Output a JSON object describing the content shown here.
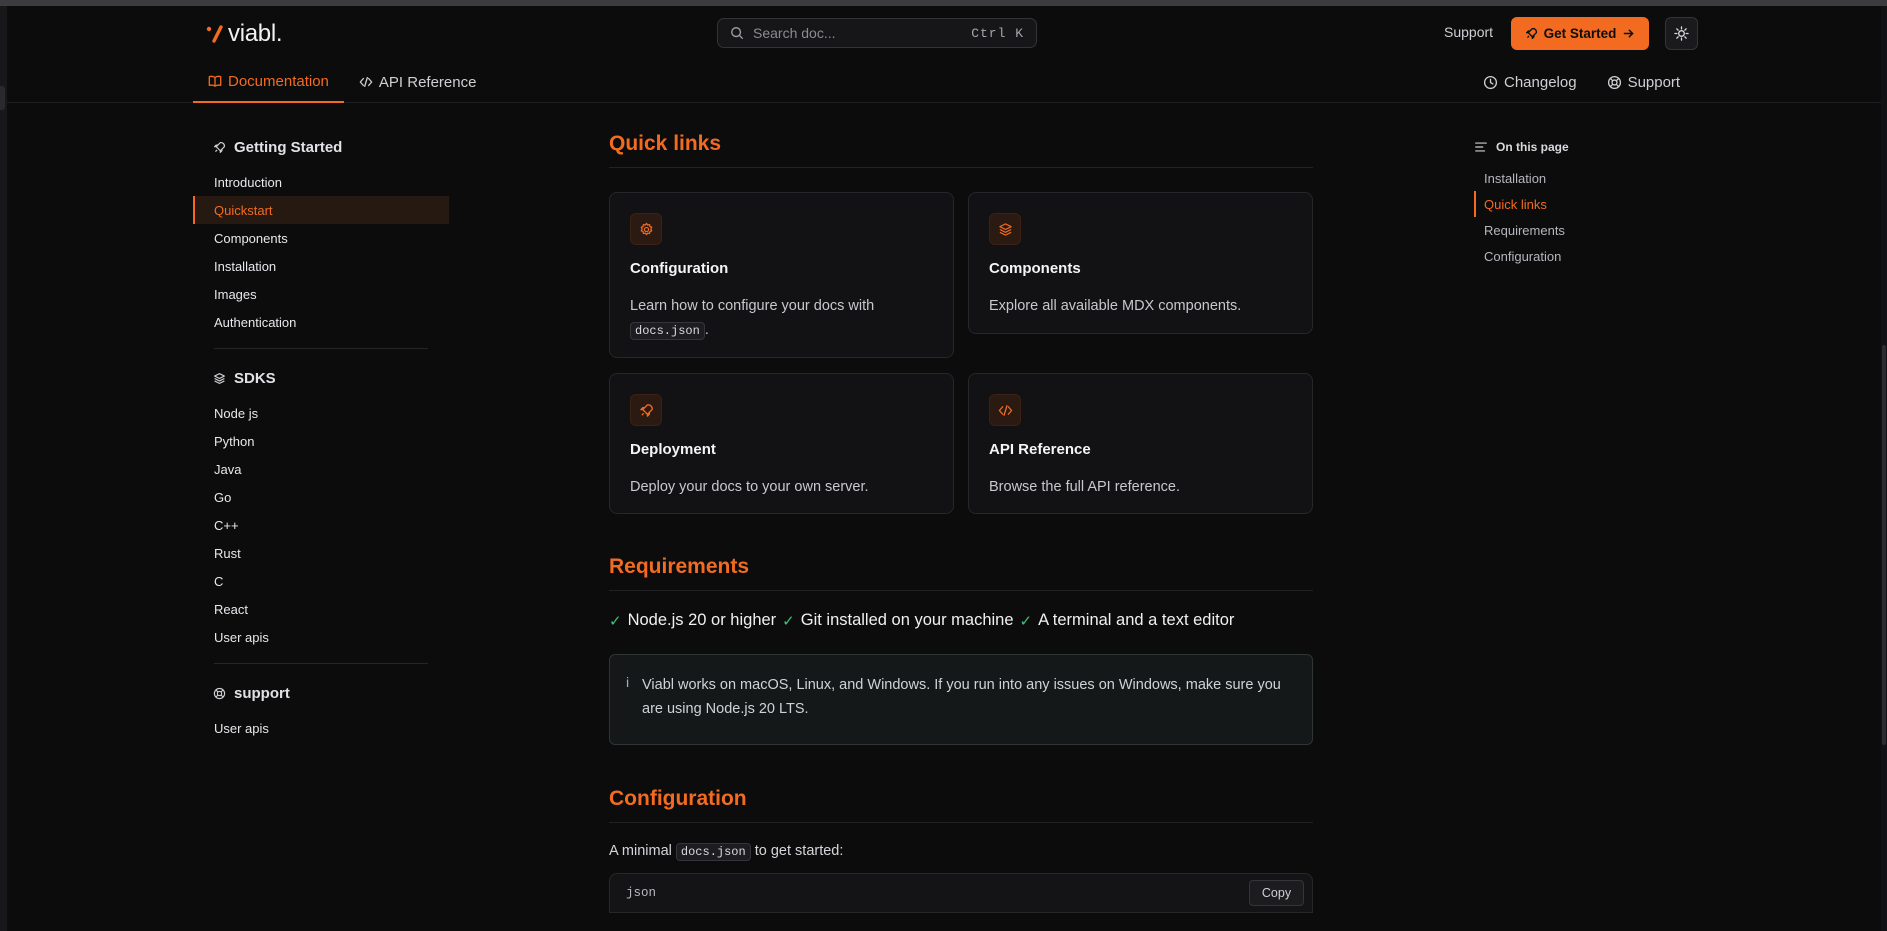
{
  "colors": {
    "accent": "#f26b21",
    "check": "#3fbf7f",
    "bg": "#0c0c0d"
  },
  "header": {
    "logo_text": "viabl.",
    "search": {
      "placeholder": "Search doc...",
      "shortcut": "Ctrl K"
    },
    "support_label": "Support",
    "get_started_label": "Get Started",
    "theme_icon": "sun-icon"
  },
  "tabs": [
    {
      "label": "Documentation",
      "icon": "book-icon",
      "active": true
    },
    {
      "label": "API Reference",
      "icon": "code-icon",
      "active": false
    }
  ],
  "tabs_right": [
    {
      "label": "Changelog",
      "icon": "clock-icon"
    },
    {
      "label": "Support",
      "icon": "lifebuoy-icon"
    }
  ],
  "sidebar": {
    "groups": [
      {
        "title": "Getting Started",
        "icon": "rocket-icon",
        "items": [
          "Introduction",
          "Quickstart",
          "Components",
          "Installation",
          "Images",
          "Authentication"
        ],
        "active": "Quickstart"
      },
      {
        "title": "SDKS",
        "icon": "layers-icon",
        "items": [
          "Node js",
          "Python",
          "Java",
          "Go",
          "C++",
          "Rust",
          "C",
          "React",
          "User apis"
        ]
      },
      {
        "title": "support",
        "icon": "lifebuoy-icon",
        "items": [
          "User apis"
        ]
      }
    ]
  },
  "main": {
    "quick_links": {
      "heading": "Quick links",
      "cards": [
        {
          "icon": "gear-icon",
          "title": "Configuration",
          "desc": "Learn how to configure your docs with",
          "code": "docs.json",
          "desc_end": "."
        },
        {
          "icon": "layers-icon",
          "title": "Components",
          "desc": "Explore all available MDX components."
        },
        {
          "icon": "rocket-icon",
          "title": "Deployment",
          "desc": "Deploy your docs to your own server."
        },
        {
          "icon": "code-icon",
          "title": "API Reference",
          "desc": "Browse the full API reference."
        }
      ]
    },
    "requirements": {
      "heading": "Requirements",
      "items": [
        "Node.js 20 or higher",
        "Git installed on your machine",
        "A terminal and a text editor"
      ],
      "note_icon": "i",
      "note": "Viabl works on macOS, Linux, and Windows. If you run into any issues on Windows, make sure you are using Node.js 20 LTS."
    },
    "configuration": {
      "heading": "Configuration",
      "lead_before": "A minimal",
      "lead_code": "docs.json",
      "lead_after": "to get started:",
      "code_lang": "json",
      "copy_label": "Copy"
    }
  },
  "toc": {
    "title": "On this page",
    "items": [
      "Installation",
      "Quick links",
      "Requirements",
      "Configuration"
    ],
    "active": "Quick links"
  }
}
